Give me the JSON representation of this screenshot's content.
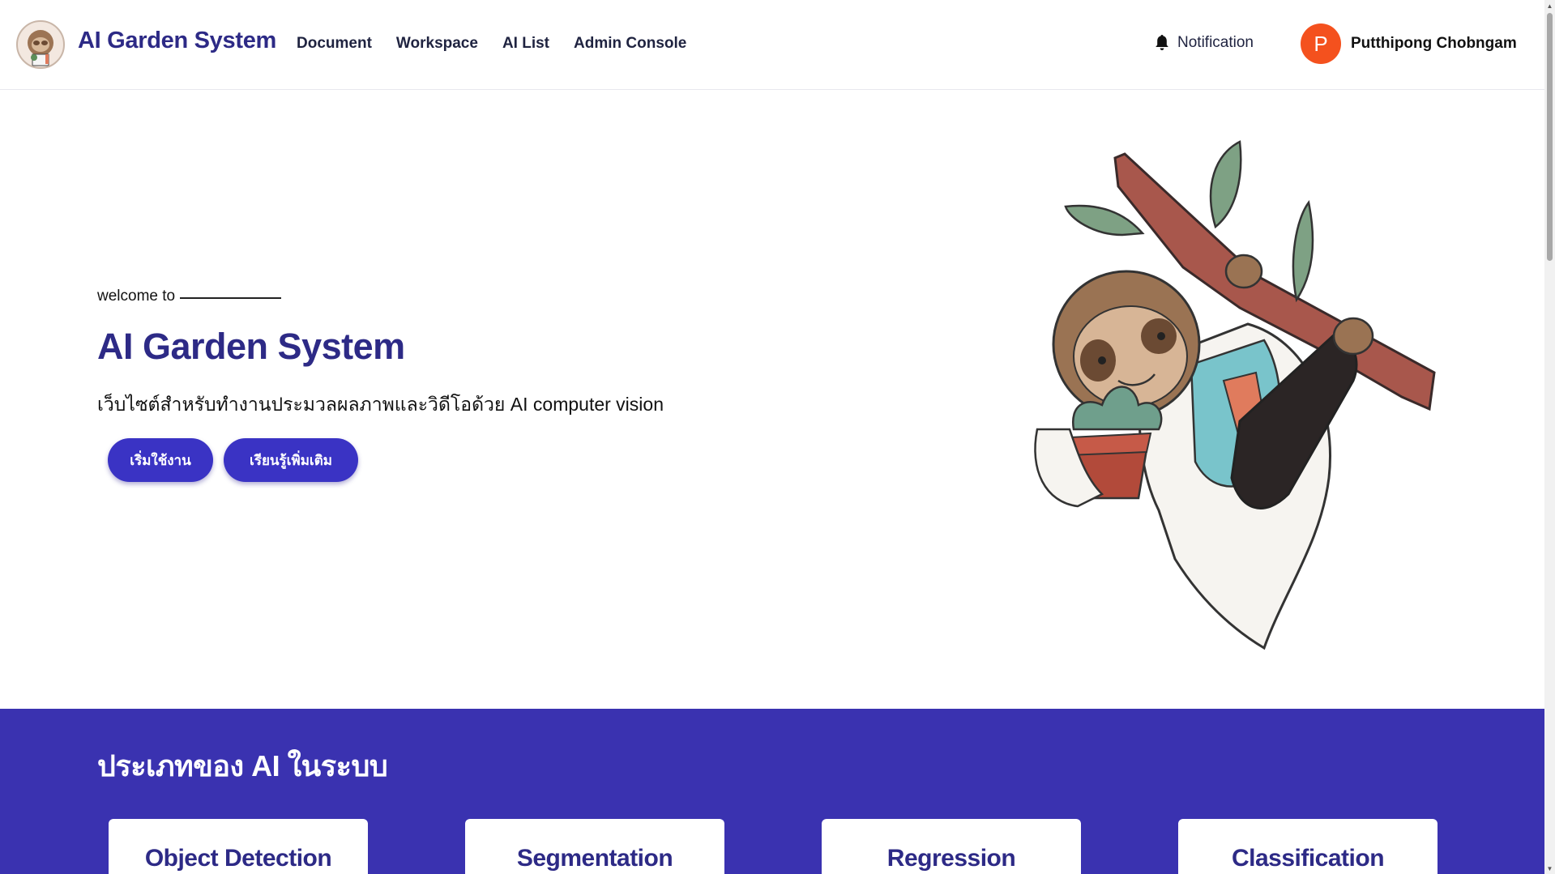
{
  "header": {
    "brand": "AI Garden System",
    "nav": [
      {
        "label": "Document"
      },
      {
        "label": "Workspace"
      },
      {
        "label": "AI List"
      },
      {
        "label": "Admin Console"
      }
    ],
    "notification_label": "Notification",
    "notification_icon": "bell-icon",
    "user": {
      "initial": "P",
      "name": "Putthipong Chobngam",
      "avatar_color": "#f4511e"
    }
  },
  "hero": {
    "welcome": "welcome to",
    "title": "AI Garden System",
    "subtitle": "เว็บไซต์สำหรับทำงานประมวลผลภาพและวิดีโอด้วย AI computer vision",
    "buttons": {
      "start": "เริ่มใช้งาน",
      "learn_more": "เรียนรู้เพิ่มเติม"
    },
    "illustration": "sloth-scientist-illustration"
  },
  "ai_types": {
    "title": "ประเภทของ AI ในระบบ",
    "cards": [
      {
        "title": "Object Detection"
      },
      {
        "title": "Segmentation"
      },
      {
        "title": "Regression"
      },
      {
        "title": "Classification"
      }
    ]
  },
  "colors": {
    "brand": "#2d2a86",
    "primary_button": "#3a33c4",
    "section_bg": "#3a32b0"
  }
}
